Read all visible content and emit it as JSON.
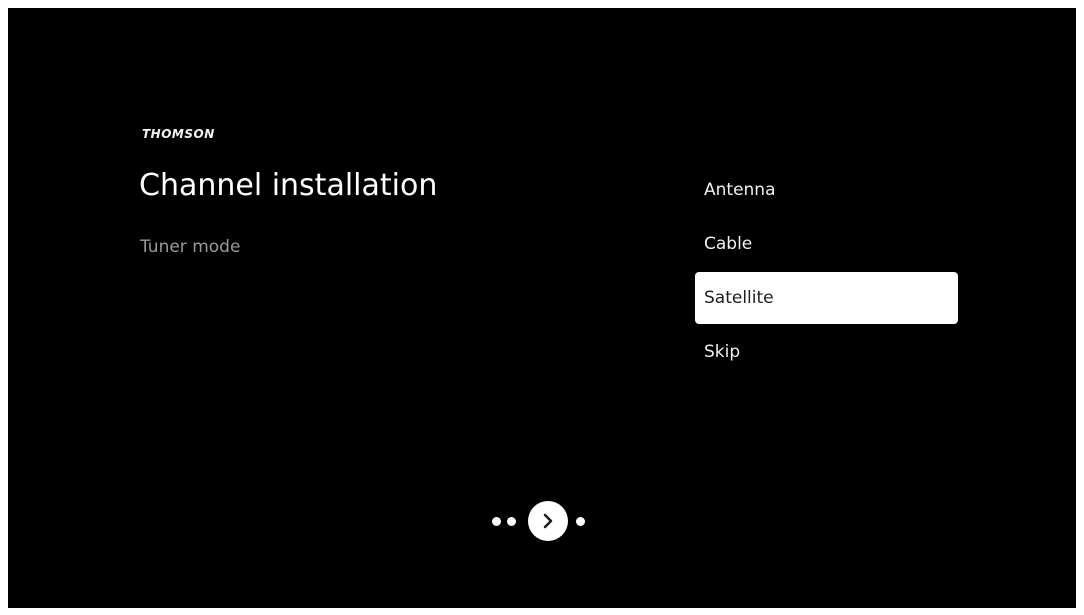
{
  "brand": "THOMSON",
  "page": {
    "title": "Channel installation",
    "subtitle": "Tuner mode"
  },
  "options": [
    {
      "label": "Antenna",
      "selected": false
    },
    {
      "label": "Cable",
      "selected": false
    },
    {
      "label": "Satellite",
      "selected": true
    },
    {
      "label": "Skip",
      "selected": false
    }
  ],
  "pager": {
    "dots_before": 2,
    "dots_after": 1,
    "next_icon": "chevron-right-icon"
  },
  "colors": {
    "background": "#000000",
    "text": "#ffffff",
    "subtitle": "#9a9a9a",
    "selected_bg": "#ffffff",
    "selected_text": "#202020"
  }
}
